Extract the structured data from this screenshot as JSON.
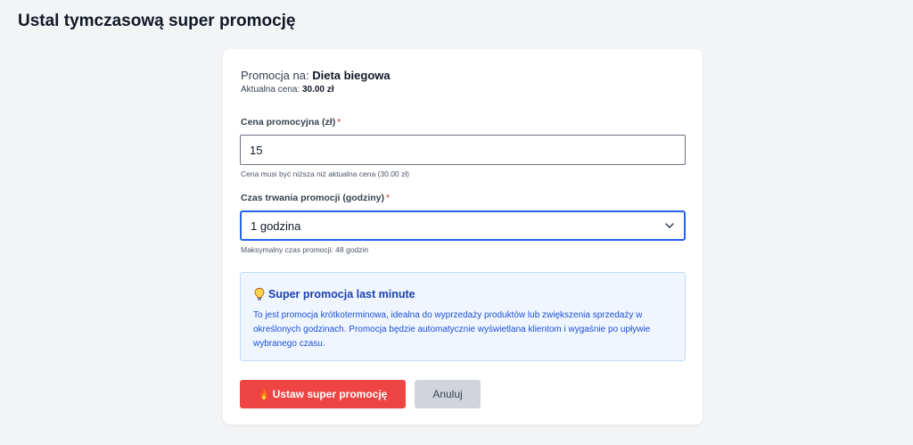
{
  "page": {
    "title": "Ustal tymczasową super promocję"
  },
  "promo": {
    "on_label": "Promocja na:",
    "product_name": "Dieta biegowa",
    "current_price_label": "Aktualna cena:",
    "current_price": "30.00 zł"
  },
  "form": {
    "price_label": "Cena promocyjna (zł)",
    "price_value": "15",
    "price_help": "Cena musi być niższa niż aktualna cena (30.00 zł)",
    "duration_label": "Czas trwania promocji (godziny)",
    "duration_selected": "1 godzina",
    "duration_help": "Maksymalny czas promocji: 48 godzin",
    "required_mark": "*"
  },
  "info": {
    "icon": "lightbulb-icon",
    "title": "Super promocja last minute",
    "text": "To jest promocja krótkoterminowa, idealna do wyprzedaży produktów lub zwiększenia sprzedaży w określonych godzinach. Promocja będzie automatycznie wyświetlana klientom i wygaśnie po upływie wybranego czasu."
  },
  "actions": {
    "submit_icon": "fire-icon",
    "submit_label": "Ustaw super promocję",
    "cancel_label": "Anuluj"
  },
  "colors": {
    "primary_button": "#ef4444",
    "focus_border": "#2563eb",
    "info_background": "#eff6ff",
    "info_text": "#1d4ed8",
    "required": "#dc2626"
  }
}
